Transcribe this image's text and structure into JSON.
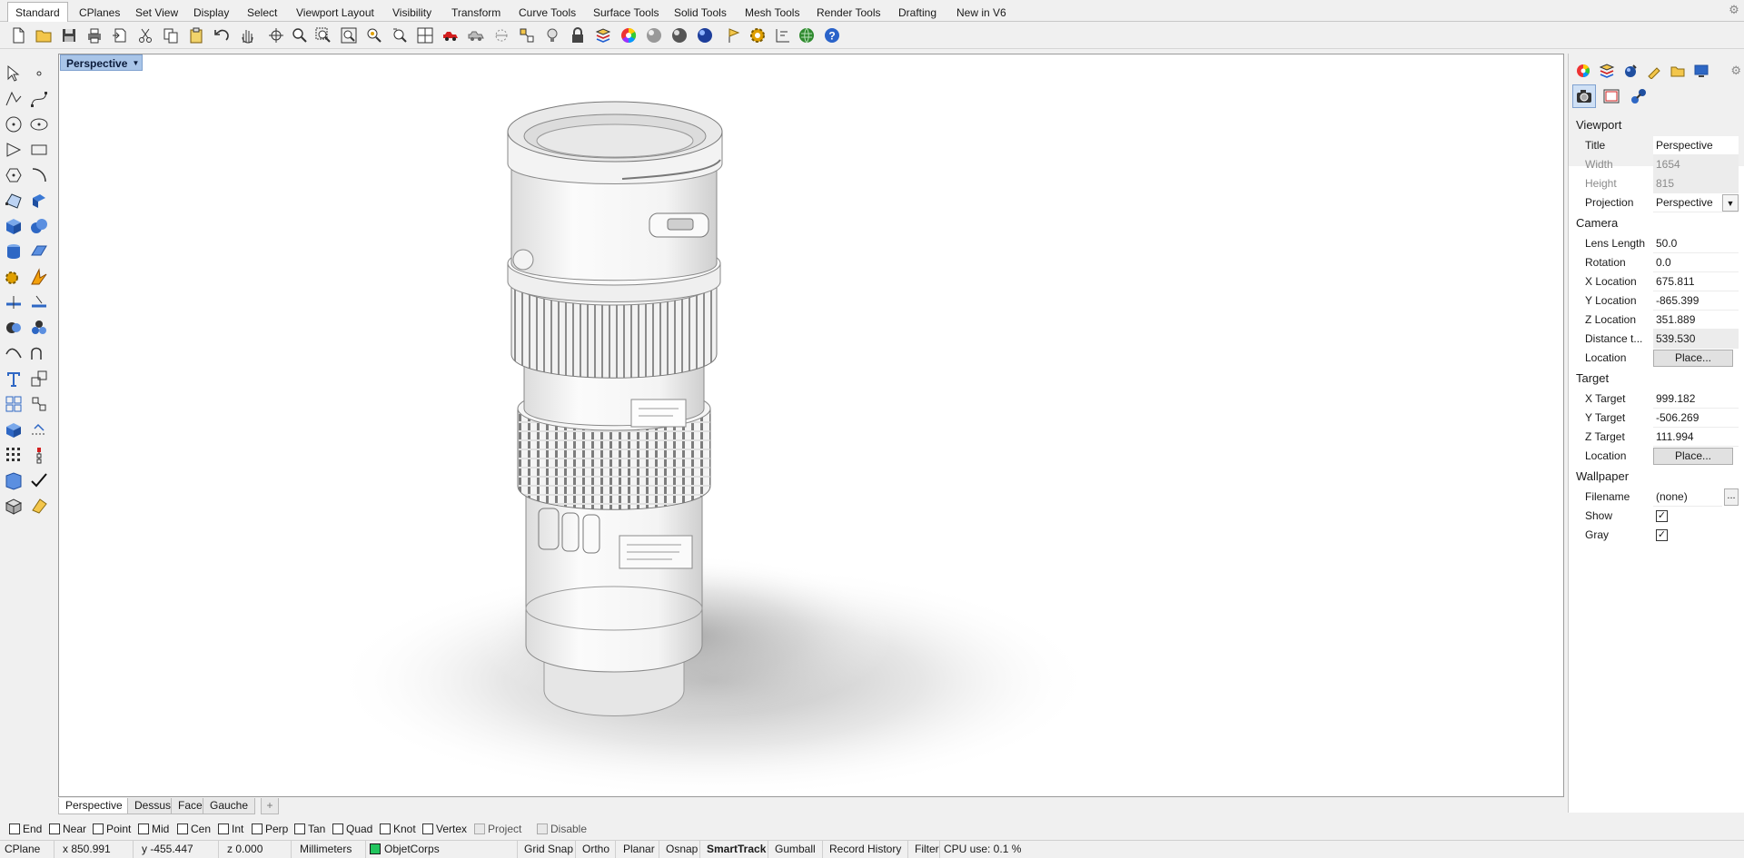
{
  "ribbon_tabs": [
    "Standard",
    "CPlanes",
    "Set View",
    "Display",
    "Select",
    "Viewport Layout",
    "Visibility",
    "Transform",
    "Curve Tools",
    "Surface Tools",
    "Solid Tools",
    "Mesh Tools",
    "Render Tools",
    "Drafting",
    "New in V6"
  ],
  "ribbon_active_tab": "Standard",
  "toolbar_icons": [
    "new-icon",
    "open-icon",
    "save-icon",
    "print-icon",
    "import-icon",
    "cut-icon",
    "copy-icon",
    "paste-icon",
    "undo-icon",
    "pan-icon",
    "rotate-view-icon",
    "zoom-icon",
    "zoom-window-icon",
    "zoom-extents-icon",
    "zoom-selected-icon",
    "undo-view-icon",
    "viewport-grid-icon",
    "car-icon",
    "shade-icon",
    "ghost-icon",
    "snap-grid-icon",
    "light-icon",
    "lock-icon",
    "layers-icon",
    "color-wheel-icon",
    "sphere-icon",
    "render-sphere-icon",
    "blue-sphere-icon",
    "flag-icon",
    "settings-gear-icon",
    "dimension-icon",
    "globe-icon",
    "help-icon"
  ],
  "left_tool_icons": [
    "pointer-icon",
    "point-icon",
    "polyline-icon",
    "curve-pts-icon",
    "circle-icon",
    "ellipse-icon",
    "arc-icon",
    "rectangle-icon",
    "polygon-icon",
    "fillet-curve-icon",
    "surface-pts-icon",
    "extrude-icon",
    "box-icon",
    "sphere-solid-icon",
    "cylinder-icon",
    "plane-icon",
    "gear-tool-icon",
    "explode-icon",
    "split-icon",
    "trim-icon",
    "boolean-icon",
    "group-icon",
    "curve-edit-icon",
    "blend-icon",
    "text-icon",
    "scale-icon",
    "array-icon",
    "array-polar-icon",
    "dimension-tool-icon",
    "match-icon",
    "grid-array-icon",
    "history-icon",
    "layout-icon",
    "check-icon",
    "mesh-icon",
    "paint-icon"
  ],
  "viewport": {
    "title": "Perspective",
    "tabs": [
      "Perspective",
      "Dessus",
      "Face",
      "Gauche"
    ],
    "active_tab": "Perspective",
    "add_tab_symbol": "+"
  },
  "osnaps": [
    {
      "label": "End",
      "checked": false,
      "enabled": true
    },
    {
      "label": "Near",
      "checked": false,
      "enabled": true
    },
    {
      "label": "Point",
      "checked": false,
      "enabled": true
    },
    {
      "label": "Mid",
      "checked": false,
      "enabled": true
    },
    {
      "label": "Cen",
      "checked": false,
      "enabled": true
    },
    {
      "label": "Int",
      "checked": false,
      "enabled": true
    },
    {
      "label": "Perp",
      "checked": false,
      "enabled": true
    },
    {
      "label": "Tan",
      "checked": false,
      "enabled": true
    },
    {
      "label": "Quad",
      "checked": false,
      "enabled": true
    },
    {
      "label": "Knot",
      "checked": false,
      "enabled": true
    },
    {
      "label": "Vertex",
      "checked": false,
      "enabled": true
    },
    {
      "label": "Project",
      "checked": false,
      "enabled": false
    },
    {
      "label": "Disable",
      "checked": false,
      "enabled": false
    }
  ],
  "status": {
    "cplane": "CPlane",
    "x": "x 850.991",
    "y": "y -455.447",
    "z": "z 0.000",
    "units": "Millimeters",
    "layer": "ObjetCorps",
    "layer_color": "#22c55e",
    "grid_snap": "Grid Snap",
    "ortho": "Ortho",
    "planar": "Planar",
    "osnap": "Osnap",
    "smarttrack": "SmartTrack",
    "gumball": "Gumball",
    "record_history": "Record History",
    "filter": "Filter",
    "cpu": "CPU use: 0.1 %"
  },
  "panel": {
    "tab_icons": [
      "color-wheel-icon",
      "layers-icon",
      "material-icon",
      "brush-icon",
      "folder-icon",
      "display-icon"
    ],
    "subtab_icons": [
      "camera-icon",
      "frame-icon",
      "link-icon"
    ],
    "viewport_section": "Viewport",
    "title_label": "Title",
    "title_value": "Perspective",
    "width_label": "Width",
    "width_value": "1654",
    "height_label": "Height",
    "height_value": "815",
    "projection_label": "Projection",
    "projection_value": "Perspective",
    "camera_section": "Camera",
    "lens_label": "Lens Length",
    "lens_value": "50.0",
    "rotation_label": "Rotation",
    "rotation_value": "0.0",
    "xloc_label": "X Location",
    "xloc_value": "675.811",
    "yloc_label": "Y Location",
    "yloc_value": "-865.399",
    "zloc_label": "Z Location",
    "zloc_value": "351.889",
    "dist_label": "Distance t...",
    "dist_value": "539.530",
    "cam_location_label": "Location",
    "cam_location_button": "Place...",
    "target_section": "Target",
    "xt_label": "X Target",
    "xt_value": "999.182",
    "yt_label": "Y Target",
    "yt_value": "-506.269",
    "zt_label": "Z Target",
    "zt_value": "111.994",
    "tgt_location_label": "Location",
    "tgt_location_button": "Place...",
    "wallpaper_section": "Wallpaper",
    "filename_label": "Filename",
    "filename_value": "(none)",
    "filename_button": "...",
    "show_label": "Show",
    "show_checked": true,
    "gray_label": "Gray",
    "gray_checked": true
  }
}
